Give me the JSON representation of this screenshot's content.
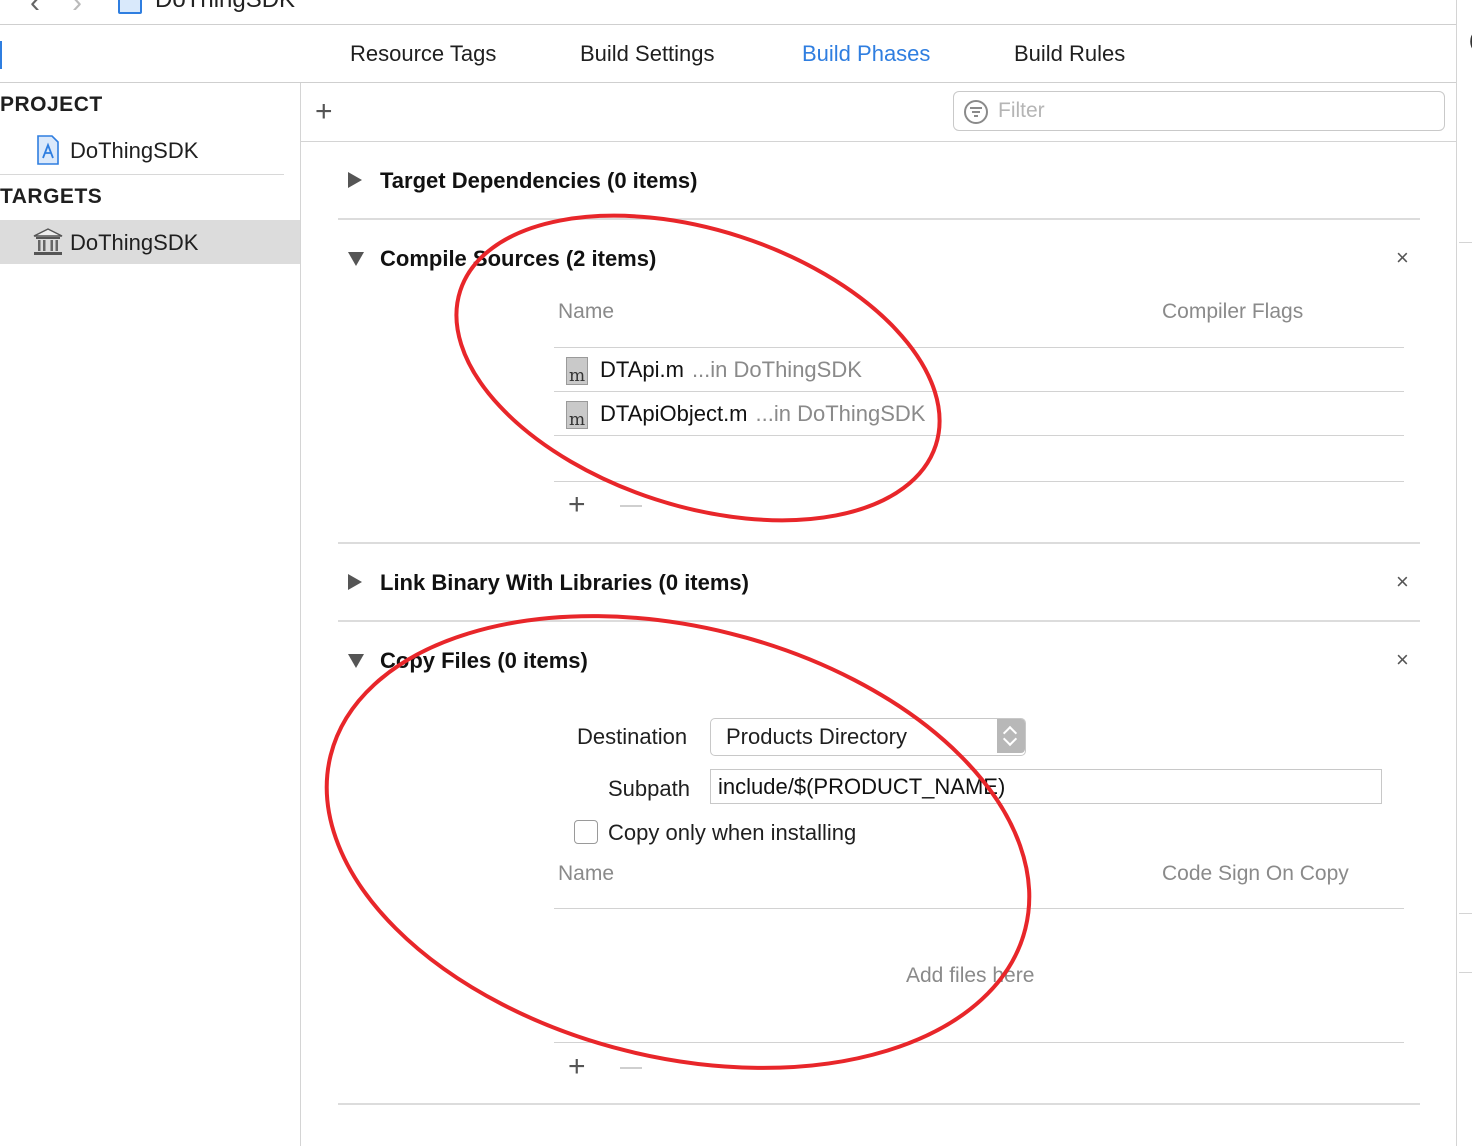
{
  "topbar": {
    "crumb": "DoThingSDK"
  },
  "tabs": [
    {
      "label": "Resource Tags"
    },
    {
      "label": "Build Settings"
    },
    {
      "label": "Build Phases"
    },
    {
      "label": "Build Rules"
    }
  ],
  "sidebar": {
    "project_heading": "PROJECT",
    "project_item": "DoThingSDK",
    "targets_heading": "TARGETS",
    "target_item": "DoThingSDK"
  },
  "toolbar": {
    "filter_placeholder": "Filter",
    "add_symbol": "+"
  },
  "phases": {
    "target_dependencies": {
      "title": "Target Dependencies (0 items)"
    },
    "compile_sources": {
      "title": "Compile Sources (2 items)",
      "col_name": "Name",
      "col_flags": "Compiler Flags",
      "files": [
        {
          "icon": "m",
          "name": "DTApi.m",
          "location": "...in DoThingSDK"
        },
        {
          "icon": "m",
          "name": "DTApiObject.m",
          "location": "...in DoThingSDK"
        }
      ]
    },
    "link_binary": {
      "title": "Link Binary With Libraries (0 items)"
    },
    "copy_files": {
      "title": "Copy Files (0 items)",
      "destination_label": "Destination",
      "destination_value": "Products Directory",
      "subpath_label": "Subpath",
      "subpath_value": "include/$(PRODUCT_NAME)",
      "checkbox_label": "Copy only when installing",
      "col_name": "Name",
      "col_codesign": "Code Sign On Copy",
      "empty_hint": "Add files here"
    }
  },
  "icons": {
    "close": "×",
    "add": "+"
  },
  "colors": {
    "accent": "#2f7ee0",
    "annotation": "#e8262a"
  }
}
